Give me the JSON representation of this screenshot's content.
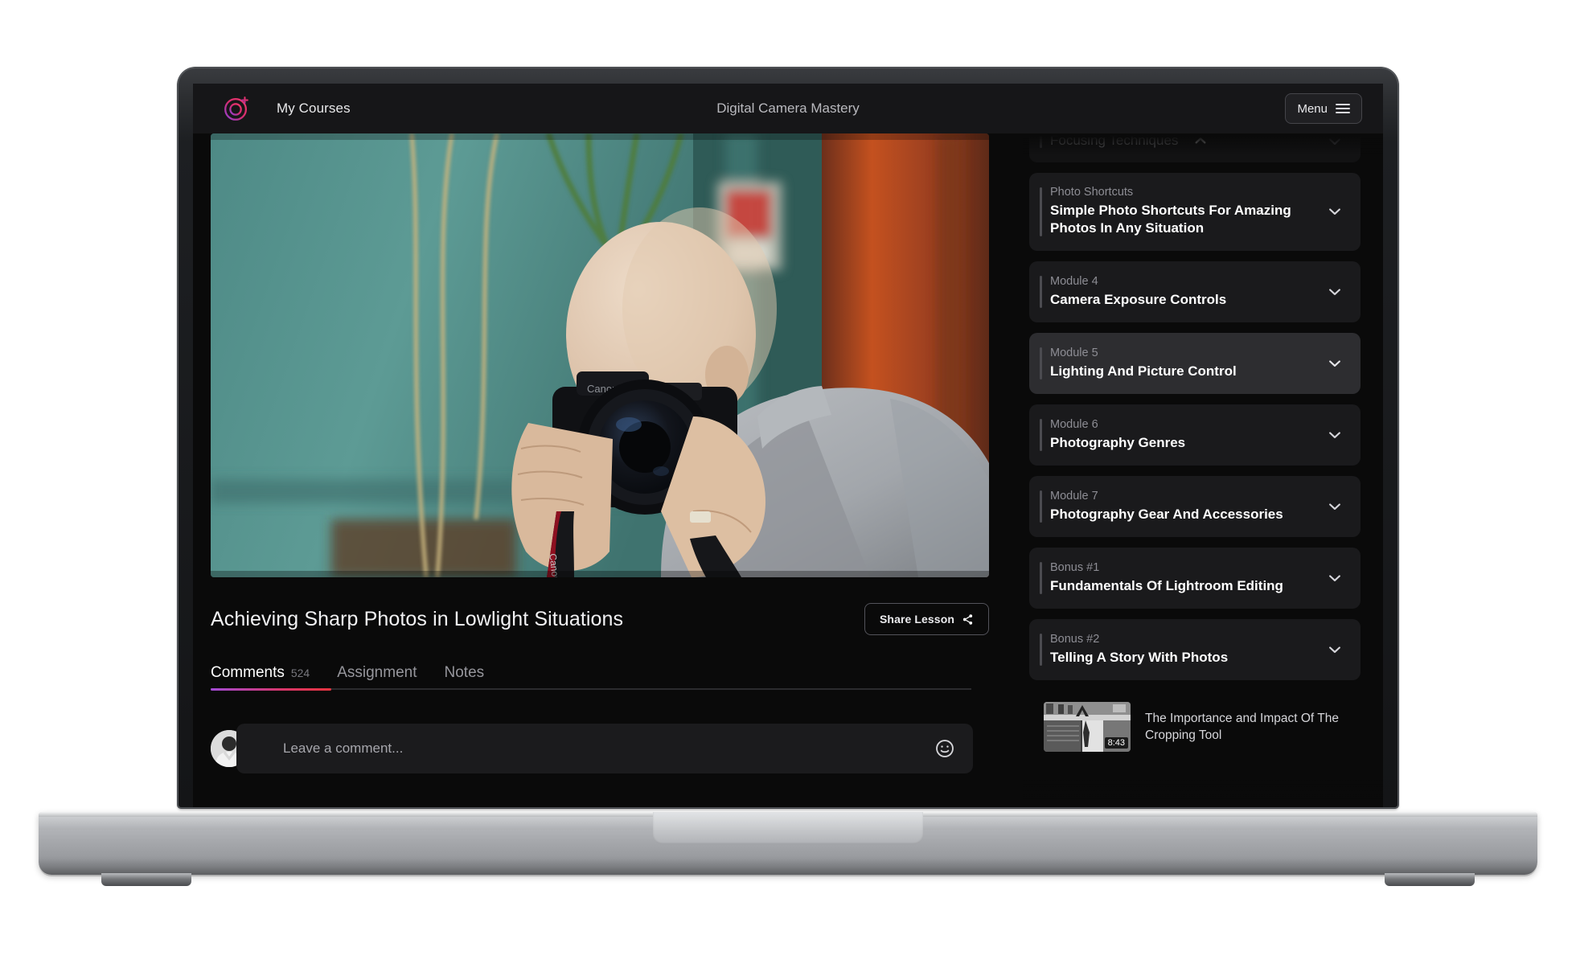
{
  "header": {
    "logo_icon": "spark-circle-logo-icon",
    "nav_link": "My Courses",
    "course_title": "Digital Camera Mastery",
    "menu_label": "Menu",
    "menu_icon": "hamburger-icon"
  },
  "colors": {
    "accent_pink": "#d8366a",
    "accent_purple": "#a24bd6",
    "accent_red": "#e8343f",
    "app_bg": "#0a0a0a",
    "panel_bg": "#1a1a1c",
    "panel_active_bg": "#2d2d30"
  },
  "lesson": {
    "title": "Achieving Sharp Photos in Lowlight Situations",
    "share_label": "Share Lesson",
    "share_icon": "share-icon",
    "video_alt": "photographer-holding-dslr-camera"
  },
  "tabs": [
    {
      "label": "Comments",
      "count": "524",
      "active": true
    },
    {
      "label": "Assignment",
      "count": "",
      "active": false
    },
    {
      "label": "Notes",
      "count": "",
      "active": false
    }
  ],
  "comment": {
    "placeholder": "Leave a comment...",
    "avatar_icon": "user-avatar",
    "emoji_icon": "smiley-face-icon"
  },
  "sidebar": {
    "modules": [
      {
        "kicker": "",
        "name": "Focusing Techniques",
        "chevron": "chevron-up-icon",
        "state": "expanded-partial"
      },
      {
        "kicker": "Photo Shortcuts",
        "name": "Simple Photo Shortcuts For Amazing Photos In Any Situation",
        "chevron": "chevron-down-icon",
        "state": "collapsed"
      },
      {
        "kicker": "Module 4",
        "name": "Camera Exposure Controls",
        "chevron": "chevron-down-icon",
        "state": "collapsed"
      },
      {
        "kicker": "Module 5",
        "name": "Lighting And Picture Control",
        "chevron": "chevron-down-icon",
        "state": "active"
      },
      {
        "kicker": "Module 6",
        "name": "Photography Genres",
        "chevron": "chevron-down-icon",
        "state": "collapsed"
      },
      {
        "kicker": "Module 7",
        "name": "Photography Gear And Accessories",
        "chevron": "chevron-down-icon",
        "state": "collapsed"
      },
      {
        "kicker": "Bonus #1",
        "name": "Fundamentals Of Lightroom Editing",
        "chevron": "chevron-down-icon",
        "state": "collapsed"
      },
      {
        "kicker": "Bonus #2",
        "name": "Telling A Story With Photos",
        "chevron": "chevron-down-icon",
        "state": "expanded"
      }
    ],
    "lessons": [
      {
        "title": "The Importance and Impact Of The Cropping Tool",
        "duration": "8:43",
        "thumb_alt": "black-and-white-street-scene"
      }
    ]
  }
}
